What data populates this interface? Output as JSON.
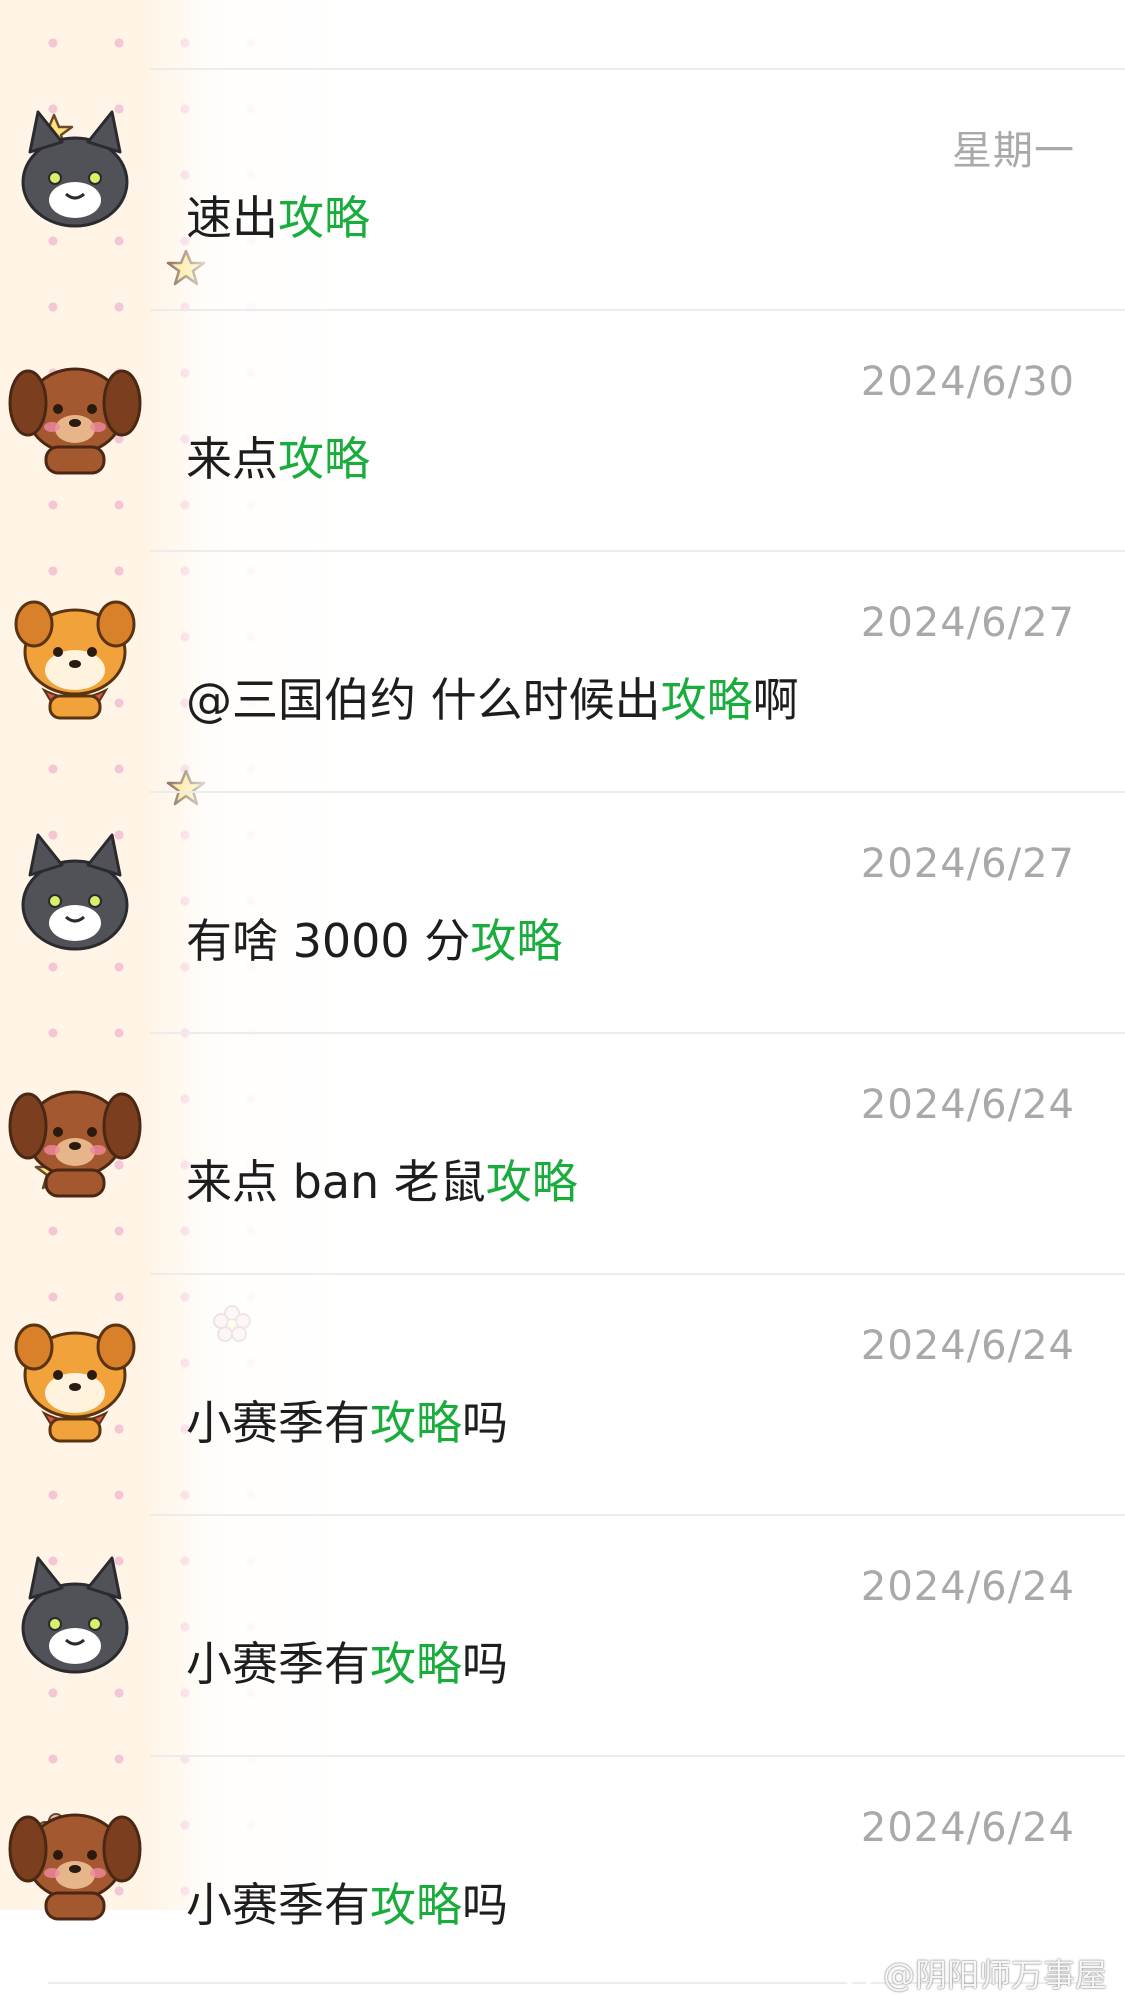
{
  "conversations": [
    {
      "date": "星期一",
      "text_before": "速出",
      "highlight": "攻略",
      "text_after": "",
      "avatar": "gray-cat-sticker-icon"
    },
    {
      "date": "2024/6/30",
      "text_before": "来点",
      "highlight": "攻略",
      "text_after": "",
      "avatar": "brown-puppy-sticker-icon"
    },
    {
      "date": "2024/6/27",
      "text_before": "@三国伯约 什么时候出",
      "highlight": "攻略",
      "text_after": "啊",
      "avatar": "orange-shiba-sticker-icon"
    },
    {
      "date": "2024/6/27",
      "text_before": "有啥 3000 分",
      "highlight": "攻略",
      "text_after": "",
      "avatar": "gray-cat-sticker-icon"
    },
    {
      "date": "2024/6/24",
      "text_before": "来点 ban 老鼠",
      "highlight": "攻略",
      "text_after": "",
      "avatar": "brown-puppy-sticker-icon"
    },
    {
      "date": "2024/6/24",
      "text_before": "小赛季有",
      "highlight": "攻略",
      "text_after": "吗",
      "avatar": "orange-shiba-sticker-icon"
    },
    {
      "date": "2024/6/24",
      "text_before": "小赛季有",
      "highlight": "攻略",
      "text_after": "吗",
      "avatar": "gray-cat-sticker-icon"
    },
    {
      "date": "2024/6/24",
      "text_before": "小赛季有",
      "highlight": "攻略",
      "text_after": "吗",
      "avatar": "brown-puppy-sticker-icon"
    }
  ],
  "watermark": "@阴阳师万事屋",
  "colors": {
    "highlight": "#1aad3e",
    "date": "#a9a9a9",
    "text": "#1d1d1d",
    "divider": "#ececec"
  }
}
